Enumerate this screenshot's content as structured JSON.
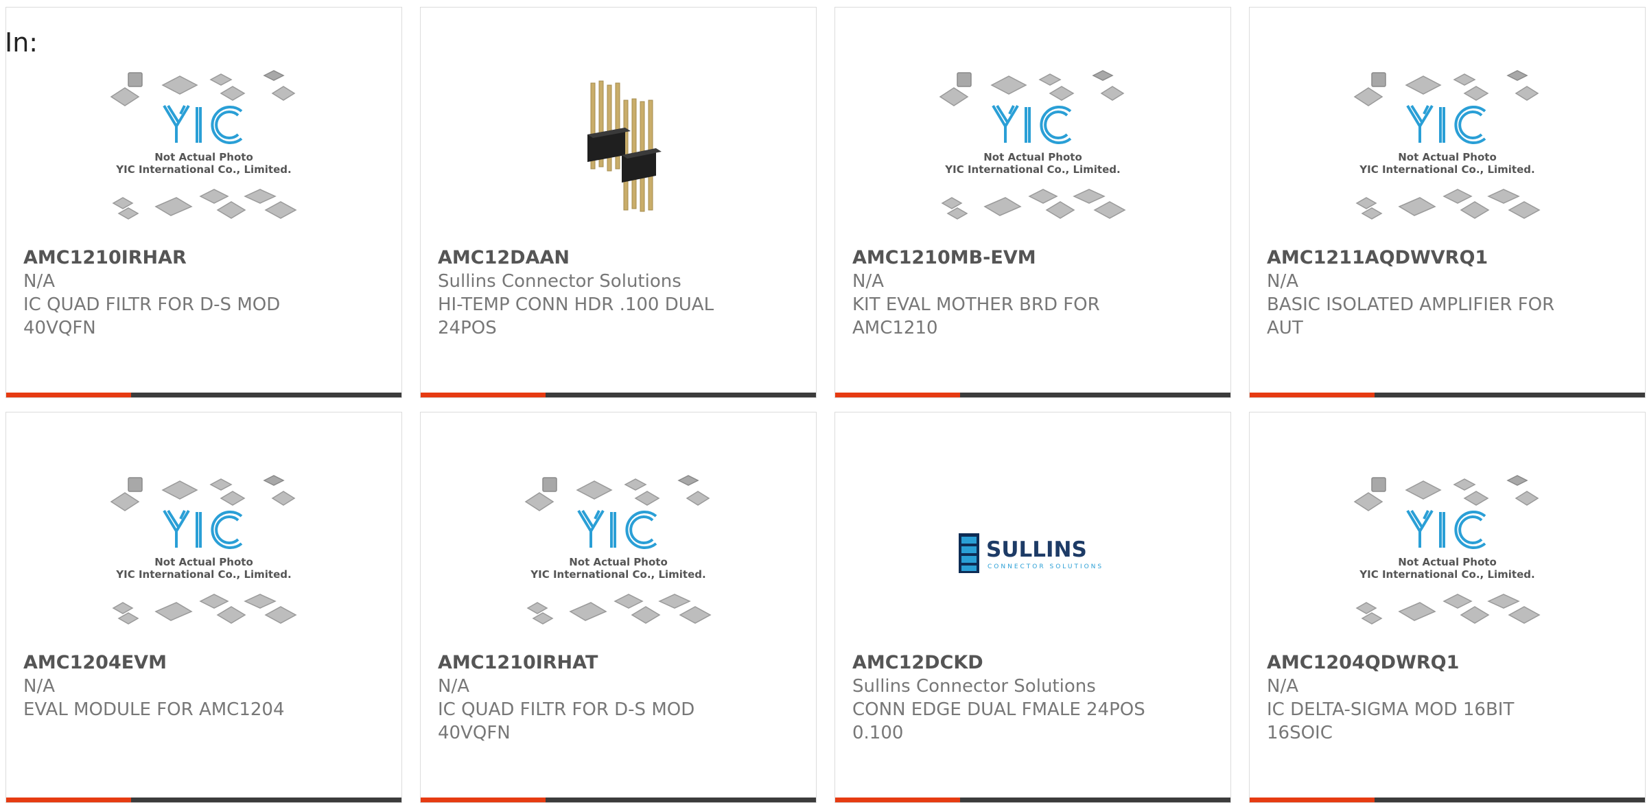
{
  "filter": {
    "label": "In:"
  },
  "placeholder_image": {
    "brand": "YIC",
    "line1": "Not Actual Photo",
    "line2": "YIC International Co., Limited."
  },
  "sullins_logo": {
    "name": "SULLINS",
    "tagline": "CONNECTOR SOLUTIONS"
  },
  "colors": {
    "accent": "#e63b12",
    "bar": "#3c3c3c",
    "logo_blue": "#2a9fd6"
  },
  "products": [
    {
      "part_number": "AMC1210IRHAR",
      "manufacturer": "N/A",
      "desc_line1": "IC QUAD FILTR FOR D-S MOD",
      "desc_line2": "40VQFN",
      "image": "yic-placeholder"
    },
    {
      "part_number": "AMC12DAAN",
      "manufacturer": "Sullins Connector Solutions",
      "desc_line1": "HI-TEMP CONN HDR .100 DUAL",
      "desc_line2": "24POS",
      "image": "pin-header-photo"
    },
    {
      "part_number": "AMC1210MB-EVM",
      "manufacturer": "N/A",
      "desc_line1": "KIT EVAL MOTHER BRD FOR",
      "desc_line2": "AMC1210",
      "image": "yic-placeholder"
    },
    {
      "part_number": "AMC1211AQDWVRQ1",
      "manufacturer": "N/A",
      "desc_line1": "BASIC ISOLATED AMPLIFIER FOR",
      "desc_line2": "AUT",
      "image": "yic-placeholder"
    },
    {
      "part_number": "AMC1204EVM",
      "manufacturer": "N/A",
      "desc_line1": "EVAL MODULE FOR AMC1204",
      "desc_line2": "",
      "image": "yic-placeholder"
    },
    {
      "part_number": "AMC1210IRHAT",
      "manufacturer": "N/A",
      "desc_line1": "IC QUAD FILTR FOR D-S MOD",
      "desc_line2": "40VQFN",
      "image": "yic-placeholder"
    },
    {
      "part_number": "AMC12DCKD",
      "manufacturer": "Sullins Connector Solutions",
      "desc_line1": "CONN EDGE DUAL FMALE 24POS",
      "desc_line2": "0.100",
      "image": "sullins-logo"
    },
    {
      "part_number": "AMC1204QDWRQ1",
      "manufacturer": "N/A",
      "desc_line1": "IC DELTA-SIGMA MOD 16BIT",
      "desc_line2": "16SOIC",
      "image": "yic-placeholder"
    }
  ]
}
